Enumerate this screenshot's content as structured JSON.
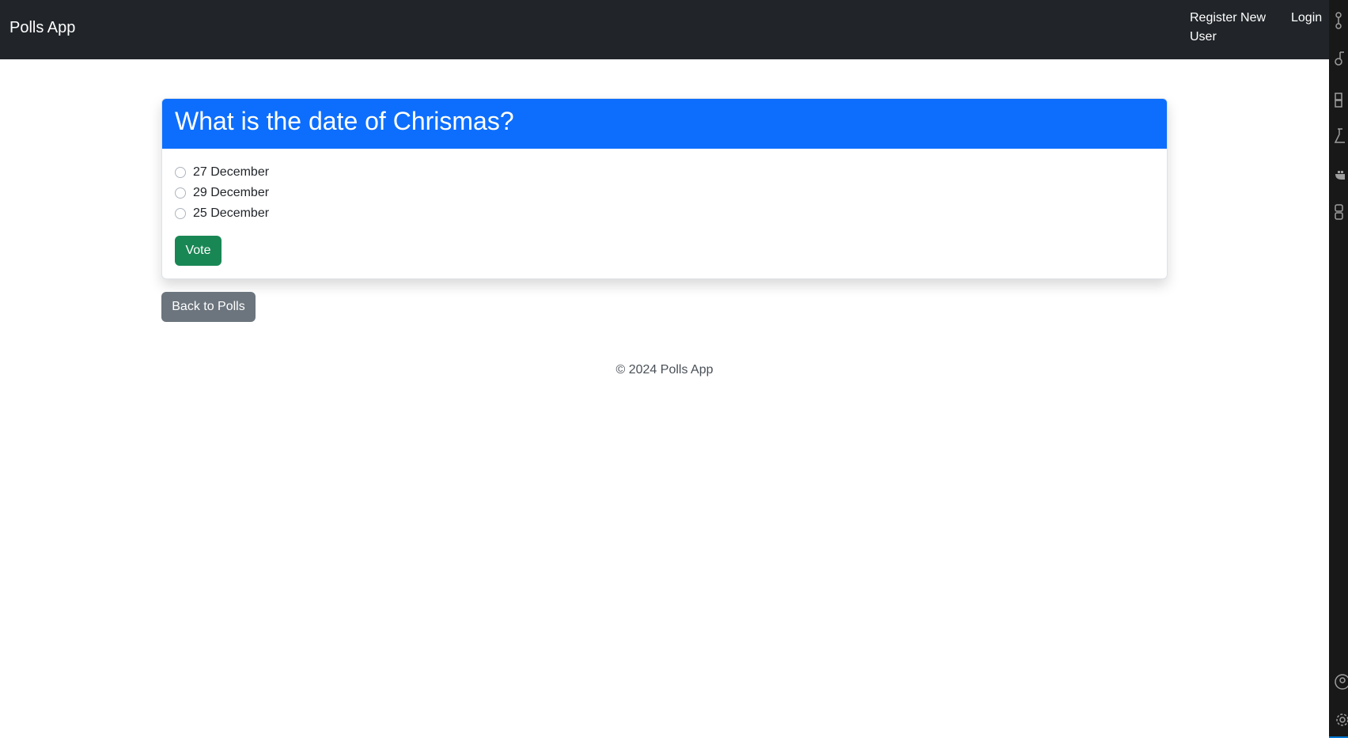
{
  "navbar": {
    "brand": "Polls App",
    "links": [
      "Register New User",
      "Login"
    ]
  },
  "poll": {
    "question": "What is the date of Chrismas?",
    "choices": [
      "27 December",
      "29 December",
      "25 December"
    ],
    "vote_label": "Vote"
  },
  "back_label": "Back to Polls",
  "footer": "© 2024 Polls App",
  "colors": {
    "navbar": "#212529",
    "card_header": "#0d6efd",
    "vote_button": "#198754",
    "back_button": "#6c757d"
  },
  "sidebar_icons": [
    "source-control-icon",
    "debug-icon",
    "extensions-icon",
    "testing-icon",
    "docker-icon",
    "remote-explorer-icon",
    "account-icon",
    "settings-gear-icon"
  ]
}
